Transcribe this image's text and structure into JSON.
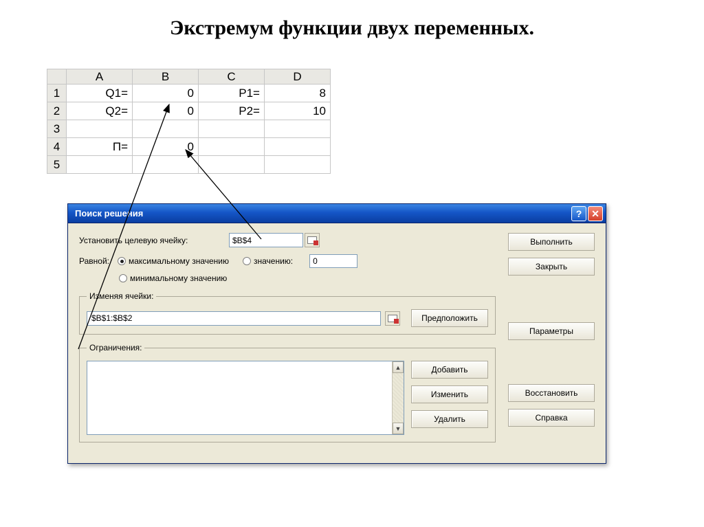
{
  "page_title": "Экстремум функции двух переменных.",
  "spreadsheet": {
    "columns": [
      "A",
      "B",
      "C",
      "D"
    ],
    "rows": [
      {
        "num": "1",
        "A": "Q1=",
        "B": "0",
        "C": "P1=",
        "D": "8"
      },
      {
        "num": "2",
        "A": "Q2=",
        "B": "0",
        "C": "P2=",
        "D": "10"
      },
      {
        "num": "3",
        "A": "",
        "B": "",
        "C": "",
        "D": ""
      },
      {
        "num": "4",
        "A": "П=",
        "B": "0",
        "C": "",
        "D": ""
      },
      {
        "num": "5",
        "A": "",
        "B": "",
        "C": "",
        "D": ""
      }
    ]
  },
  "dialog": {
    "title": "Поиск решения",
    "target_label": "Установить целевую ячейку:",
    "target_value": "$B$4",
    "equal_label": "Равной:",
    "radio_max": "максимальному значению",
    "radio_val": "значению:",
    "radio_min": "минимальному значению",
    "value_input": "0",
    "changing_legend": "Изменяя ячейки:",
    "changing_value": "$B$1:$B$2",
    "guess_btn": "Предположить",
    "constraints_legend": "Ограничения:",
    "btn_add": "Добавить",
    "btn_change": "Изменить",
    "btn_delete": "Удалить",
    "btn_run": "Выполнить",
    "btn_close": "Закрыть",
    "btn_params": "Параметры",
    "btn_reset": "Восстановить",
    "btn_help": "Справка"
  },
  "u": {
    "ts": "ц",
    "rav": "Р",
    "max_u": "м",
    "zn": "з",
    "min_u": "м",
    "izm": "я",
    "ogr": "О",
    "predp": "П",
    "dob": "Д",
    "izmn": "И",
    "udal": "У",
    "vyp": "В",
    "zakr": "З",
    "param": "П",
    "vosst": "т",
    "sprav": "С"
  }
}
